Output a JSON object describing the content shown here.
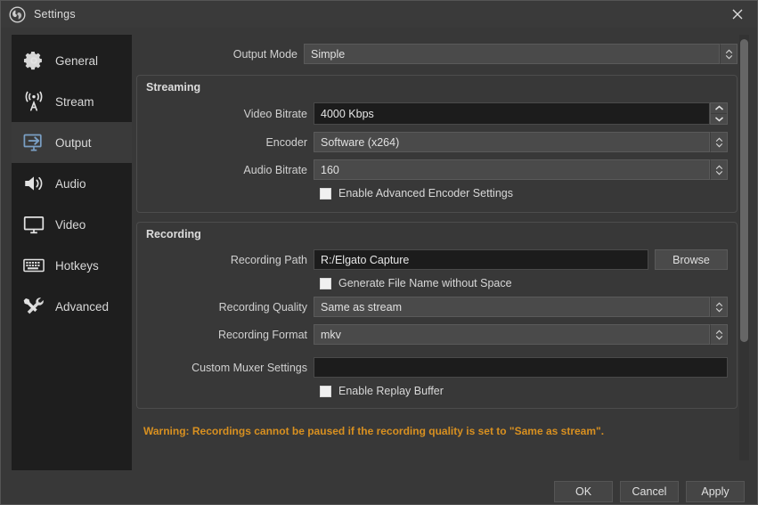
{
  "window": {
    "title": "Settings",
    "logo_icon": "obs-logo-icon",
    "close_icon": "close-icon"
  },
  "sidebar": {
    "items": [
      {
        "label": "General",
        "icon": "gear-icon",
        "selected": false
      },
      {
        "label": "Stream",
        "icon": "broadcast-icon",
        "selected": false
      },
      {
        "label": "Output",
        "icon": "monitor-arrow-icon",
        "selected": true
      },
      {
        "label": "Audio",
        "icon": "speaker-icon",
        "selected": false
      },
      {
        "label": "Video",
        "icon": "monitor-icon",
        "selected": false
      },
      {
        "label": "Hotkeys",
        "icon": "keyboard-icon",
        "selected": false
      },
      {
        "label": "Advanced",
        "icon": "tools-icon",
        "selected": false
      }
    ]
  },
  "output_mode": {
    "label": "Output Mode",
    "value": "Simple"
  },
  "streaming": {
    "title": "Streaming",
    "video_bitrate": {
      "label": "Video Bitrate",
      "value": "4000 Kbps"
    },
    "encoder": {
      "label": "Encoder",
      "value": "Software (x264)"
    },
    "audio_bitrate": {
      "label": "Audio Bitrate",
      "value": "160"
    },
    "advanced_encoder": {
      "label": "Enable Advanced Encoder Settings",
      "checked": false
    }
  },
  "recording": {
    "title": "Recording",
    "path": {
      "label": "Recording Path",
      "value": "R:/Elgato Capture",
      "browse_label": "Browse"
    },
    "no_space": {
      "label": "Generate File Name without Space",
      "checked": false
    },
    "quality": {
      "label": "Recording Quality",
      "value": "Same as stream"
    },
    "format": {
      "label": "Recording Format",
      "value": "mkv"
    },
    "muxer": {
      "label": "Custom Muxer Settings",
      "value": ""
    },
    "replay_buffer": {
      "label": "Enable Replay Buffer",
      "checked": false
    }
  },
  "warning": {
    "text": "Warning: Recordings cannot be paused if the recording quality is set to \"Same as stream\"."
  },
  "footer": {
    "ok": "OK",
    "cancel": "Cancel",
    "apply": "Apply"
  },
  "colors": {
    "accent_selected": "#7a9fc4",
    "warning": "#d89020",
    "panel_bg": "#383838",
    "sidebar_bg": "#1e1e1e"
  }
}
